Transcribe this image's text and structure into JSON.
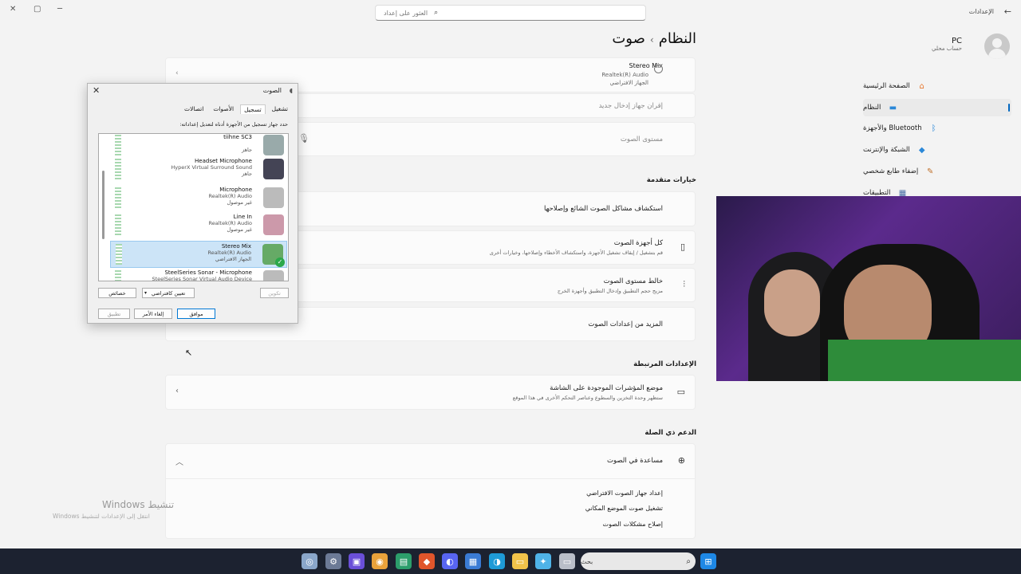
{
  "app": {
    "name": "الإعدادات",
    "back_icon": "back-arrow-icon"
  },
  "window_controls": {
    "close": "✕",
    "maximize": "▢",
    "minimize": "─"
  },
  "search": {
    "placeholder": "العثور على إعداد"
  },
  "breadcrumb": {
    "parent": "النظام",
    "separator": "›",
    "current": "صوت"
  },
  "user": {
    "name": "PC",
    "subtitle": "حساب محلي"
  },
  "nav": [
    {
      "label": "الصفحة الرئيسية",
      "icon": "home-icon",
      "glyph": "⌂",
      "color": "#e8772e"
    },
    {
      "label": "النظام",
      "icon": "monitor-icon",
      "glyph": "▬",
      "color": "#2b88d8",
      "selected": true
    },
    {
      "label": "Bluetooth والأجهزة",
      "icon": "bluetooth-icon",
      "glyph": "ᛒ",
      "color": "#2b88d8"
    },
    {
      "label": "الشبكة والإنترنت",
      "icon": "wifi-icon",
      "glyph": "◆",
      "color": "#2b88d8"
    },
    {
      "label": "إضفاء طابع شخصي",
      "icon": "brush-icon",
      "glyph": "✎",
      "color": "#c0702a"
    },
    {
      "label": "التطبيقات",
      "icon": "apps-icon",
      "glyph": "▦",
      "color": "#4a6fa5"
    }
  ],
  "input_device": {
    "name": "Stereo Mix",
    "driver": "Realtek(R) Audio",
    "status": "الجهاز الافتراضي"
  },
  "pair_new_input": "إقران جهاز إدخال جديد",
  "volume_label": "مستوى الصوت",
  "advanced": {
    "title": "خيارات متقدمة",
    "items": [
      {
        "title": "استكشاف مشاكل الصوت الشائع وإصلاحها",
        "subtitle": ""
      },
      {
        "title": "كل أجهزة الصوت",
        "subtitle": "قم بتشغيل / إيقاف تشغيل الأجهزة، واستكشاف الأخطاء وإصلاحها، وخيارات أخرى"
      },
      {
        "title": "خالط مستوى الصوت",
        "subtitle": "مزيج حجم التطبيق وإدخال التطبيق وأجهزة الخرج"
      },
      {
        "title": "المزيد من إعدادات الصوت",
        "subtitle": ""
      }
    ]
  },
  "related": {
    "title": "الإعدادات المرتبطة",
    "item_title": "موضع المؤشرات الموجودة على الشاشة",
    "item_subtitle": "ستظهر وحدة التخزين والسطوع وعناصر التحكم الأخرى في هذا الموقع"
  },
  "support": {
    "title": "الدعم ذي الصلة",
    "item_title": "مساعدة في الصوت",
    "links": [
      "إعداد جهاز الصوت الافتراضي",
      "تشغيل صوت الموضع المكاني",
      "إصلاح مشكلات الصوت"
    ]
  },
  "dialog": {
    "title": "الصوت",
    "tabs": [
      "تشغيل",
      "تسجيل",
      "الأصوات",
      "اتصالات"
    ],
    "active_tab": "تسجيل",
    "hint": "حدد جهاز تسجيل من الأجهزة أدناه لتعديل إعداداته:",
    "devices": [
      {
        "name": "tiihne SC3",
        "driver": "",
        "status": "جاهز",
        "icon": "usb-mic-icon",
        "color": "#9aa"
      },
      {
        "name": "Headset Microphone",
        "driver": "HyperX Virtual Surround Sound",
        "status": "جاهز",
        "icon": "headset-icon",
        "color": "#445"
      },
      {
        "name": "Microphone",
        "driver": "Realtek(R) Audio",
        "status": "غير موصول",
        "icon": "microphone-icon",
        "color": "#bbb"
      },
      {
        "name": "Line In",
        "driver": "Realtek(R) Audio",
        "status": "غير موصول",
        "icon": "line-in-icon",
        "color": "#c9a"
      },
      {
        "name": "Stereo Mix",
        "driver": "Realtek(R) Audio",
        "status": "الجهاز الافتراضي",
        "icon": "circuit-board-icon",
        "color": "#6a6",
        "selected": true
      },
      {
        "name": "SteelSeries Sonar - Microphone",
        "driver": "SteelSeries Sonar Virtual Audio Device",
        "status": "",
        "icon": "microphone-icon",
        "color": "#bbb"
      }
    ],
    "buttons": {
      "configure": "تكوين",
      "set_default": "تعيين كافتراضي",
      "properties": "خصائص",
      "ok": "موافق",
      "cancel": "إلغاء الأمر",
      "apply": "تطبيق"
    }
  },
  "watermark": {
    "title": "تنشيط Windows",
    "subtitle": "انتقل إلى الإعدادات لتنشيط Windows"
  },
  "taskbar": {
    "search_placeholder": "بحث",
    "apps": [
      {
        "icon": "copilot-icon",
        "glyph": "◎",
        "color": "#8aa6c9"
      },
      {
        "icon": "settings-icon",
        "glyph": "⚙",
        "color": "#6c7a96"
      },
      {
        "icon": "app-icon",
        "glyph": "▣",
        "color": "#6a4fd8"
      },
      {
        "icon": "chrome-icon",
        "glyph": "◉",
        "color": "#e9a23b"
      },
      {
        "icon": "app2-icon",
        "glyph": "▤",
        "color": "#2c9e6b"
      },
      {
        "icon": "brave-icon",
        "glyph": "◆",
        "color": "#e0552b"
      },
      {
        "icon": "discord-icon",
        "glyph": "◐",
        "color": "#5865f2"
      },
      {
        "icon": "store-icon",
        "glyph": "▦",
        "color": "#3a7bd5"
      },
      {
        "icon": "edge-icon",
        "glyph": "◑",
        "color": "#1e9bd7"
      },
      {
        "icon": "folder-icon",
        "glyph": "▭",
        "color": "#f1c34a"
      },
      {
        "icon": "copilot-app-icon",
        "glyph": "✦",
        "color": "#4fb3e8"
      },
      {
        "icon": "window-app-icon",
        "glyph": "▭",
        "color": "#b9bec8"
      }
    ],
    "start_icon": "windows-start-icon"
  }
}
